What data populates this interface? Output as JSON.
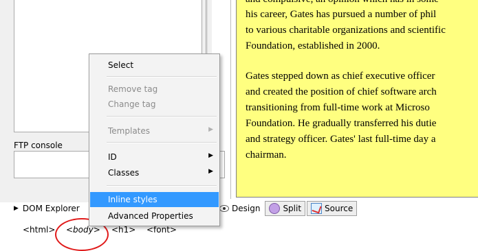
{
  "left": {
    "ftp_console_label": "FTP console",
    "dom_explorer_label": "DOM Explorer"
  },
  "tagbar": {
    "tags": [
      "<html>",
      "<body>",
      "<h1>",
      "<font>"
    ]
  },
  "view_tabs": {
    "design": "Design",
    "split": "Split",
    "source": "Source"
  },
  "document": {
    "lines": [
      "and compulsive, an opinion which has in some",
      "his career, Gates has pursued a number of phil",
      "to various charitable organizations and scientific",
      "Foundation, established in 2000.",
      "",
      "Gates stepped down as chief executive officer",
      "and created the position of chief software arch",
      "transitioning from full-time work at Microso",
      "Foundation. He gradually transferred his dutie",
      "and strategy officer. Gates' last full-time day a",
      "chairman."
    ]
  },
  "context_menu": {
    "select": "Select",
    "remove_tag": "Remove tag",
    "change_tag": "Change tag",
    "templates": "Templates",
    "id": "ID",
    "classes": "Classes",
    "inline_styles": "Inline styles",
    "advanced_properties": "Advanced Properties",
    "submenu_arrow": "▶"
  },
  "colors": {
    "highlight": "#3399ff",
    "document_bg": "#ffff80",
    "annotation_ring": "#e01a1a"
  }
}
